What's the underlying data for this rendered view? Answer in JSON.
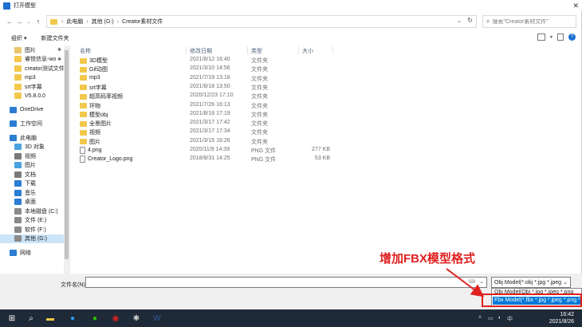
{
  "window": {
    "title": "打开模型",
    "close_glyph": "✕"
  },
  "address": {
    "crumbs": [
      "此电脑",
      "其他 (G:)",
      "Creator素材文件"
    ],
    "search_placeholder": "搜索\"Creator素材文件\""
  },
  "toolbar": {
    "organize": "组织 ▾",
    "new_folder": "新建文件夹"
  },
  "nav": {
    "items": [
      {
        "label": "图片",
        "color": "#e9c46a",
        "pinned": true,
        "level": 1
      },
      {
        "label": "睿悦信息-wo",
        "color": "#f2c94c",
        "pinned": true,
        "level": 1
      },
      {
        "label": "creator测试文件",
        "color": "#f2c94c",
        "pinned": false,
        "level": 1
      },
      {
        "label": "mp3",
        "color": "#f2c94c",
        "pinned": false,
        "level": 1
      },
      {
        "label": "srt字幕",
        "color": "#f2c94c",
        "pinned": false,
        "level": 1
      },
      {
        "label": "V5.8.0.0",
        "color": "#f2c94c",
        "pinned": false,
        "level": 1
      },
      {
        "label": "OneDrive",
        "color": "#2b7cd3",
        "pinned": false,
        "level": 0,
        "gap_before": true
      },
      {
        "label": "工作空间",
        "color": "#2b7cd3",
        "pinned": false,
        "level": 0,
        "gap_before": true
      },
      {
        "label": "此电脑",
        "color": "#2b7cd3",
        "pinned": false,
        "level": 0,
        "gap_before": true
      },
      {
        "label": "3D 对象",
        "color": "#4aa3df",
        "pinned": false,
        "level": 1
      },
      {
        "label": "视频",
        "color": "#7a7a7a",
        "pinned": false,
        "level": 1
      },
      {
        "label": "图片",
        "color": "#4aa3df",
        "pinned": false,
        "level": 1
      },
      {
        "label": "文档",
        "color": "#7a7a7a",
        "pinned": false,
        "level": 1
      },
      {
        "label": "下载",
        "color": "#2b7cd3",
        "pinned": false,
        "level": 1
      },
      {
        "label": "音乐",
        "color": "#2b7cd3",
        "pinned": false,
        "level": 1
      },
      {
        "label": "桌面",
        "color": "#2b7cd3",
        "pinned": false,
        "level": 1
      },
      {
        "label": "本地磁盘 (C:)",
        "color": "#8a8a8a",
        "pinned": false,
        "level": 1
      },
      {
        "label": "文件 (E:)",
        "color": "#8a8a8a",
        "pinned": false,
        "level": 1
      },
      {
        "label": "软件 (F:)",
        "color": "#8a8a8a",
        "pinned": false,
        "level": 1
      },
      {
        "label": "其他 (G:)",
        "color": "#8a8a8a",
        "pinned": false,
        "level": 1,
        "selected": true
      },
      {
        "label": "网络",
        "color": "#2b7cd3",
        "pinned": false,
        "level": 0,
        "gap_before": true
      }
    ]
  },
  "list": {
    "headers": [
      "名称",
      "修改日期",
      "类型",
      "大小"
    ],
    "rows": [
      {
        "name": "3D模型",
        "date": "2021/8/12 16:40",
        "type": "文件夹",
        "size": "",
        "kind": "folder"
      },
      {
        "name": "Gif动图",
        "date": "2021/3/10 14:56",
        "type": "文件夹",
        "size": "",
        "kind": "folder"
      },
      {
        "name": "mp3",
        "date": "2021/7/19 13:18",
        "type": "文件夹",
        "size": "",
        "kind": "folder"
      },
      {
        "name": "srt字幕",
        "date": "2021/8/18 13:50",
        "type": "文件夹",
        "size": "",
        "kind": "folder"
      },
      {
        "name": "超高码率视频",
        "date": "2020/12/23 17:10",
        "type": "文件夹",
        "size": "",
        "kind": "folder"
      },
      {
        "name": "环物",
        "date": "2021/7/26 16:13",
        "type": "文件夹",
        "size": "",
        "kind": "folder"
      },
      {
        "name": "模型obj",
        "date": "2021/8/18 17:19",
        "type": "文件夹",
        "size": "",
        "kind": "folder"
      },
      {
        "name": "全景图片",
        "date": "2021/3/17 17:42",
        "type": "文件夹",
        "size": "",
        "kind": "folder"
      },
      {
        "name": "视频",
        "date": "2021/3/17 17:34",
        "type": "文件夹",
        "size": "",
        "kind": "folder"
      },
      {
        "name": "图片",
        "date": "2021/3/15 16:26",
        "type": "文件夹",
        "size": "",
        "kind": "folder"
      },
      {
        "name": "4.png",
        "date": "2020/11/9 14:39",
        "type": "PNG 文件",
        "size": "277 KB",
        "kind": "png"
      },
      {
        "name": "Creator_Logo.png",
        "date": "2018/8/31 14:25",
        "type": "PNG 文件",
        "size": "53 KB",
        "kind": "png"
      }
    ]
  },
  "bottom": {
    "filename_label": "文件名(N):",
    "filename_value": "",
    "filter_selected": "Obj Model(*.obj *.jpg *.jpeg",
    "filter_options": [
      "Obj Model(Obj *.jpg *.jpeg *.png",
      "Fbx Model(*.fbx *.jpg *.jpeg *.png *"
    ]
  },
  "annotation": {
    "text": "增加FBX模型格式",
    "color": "#e02020"
  },
  "taskbar": {
    "time": "16:42",
    "date": "2021/8/26"
  }
}
